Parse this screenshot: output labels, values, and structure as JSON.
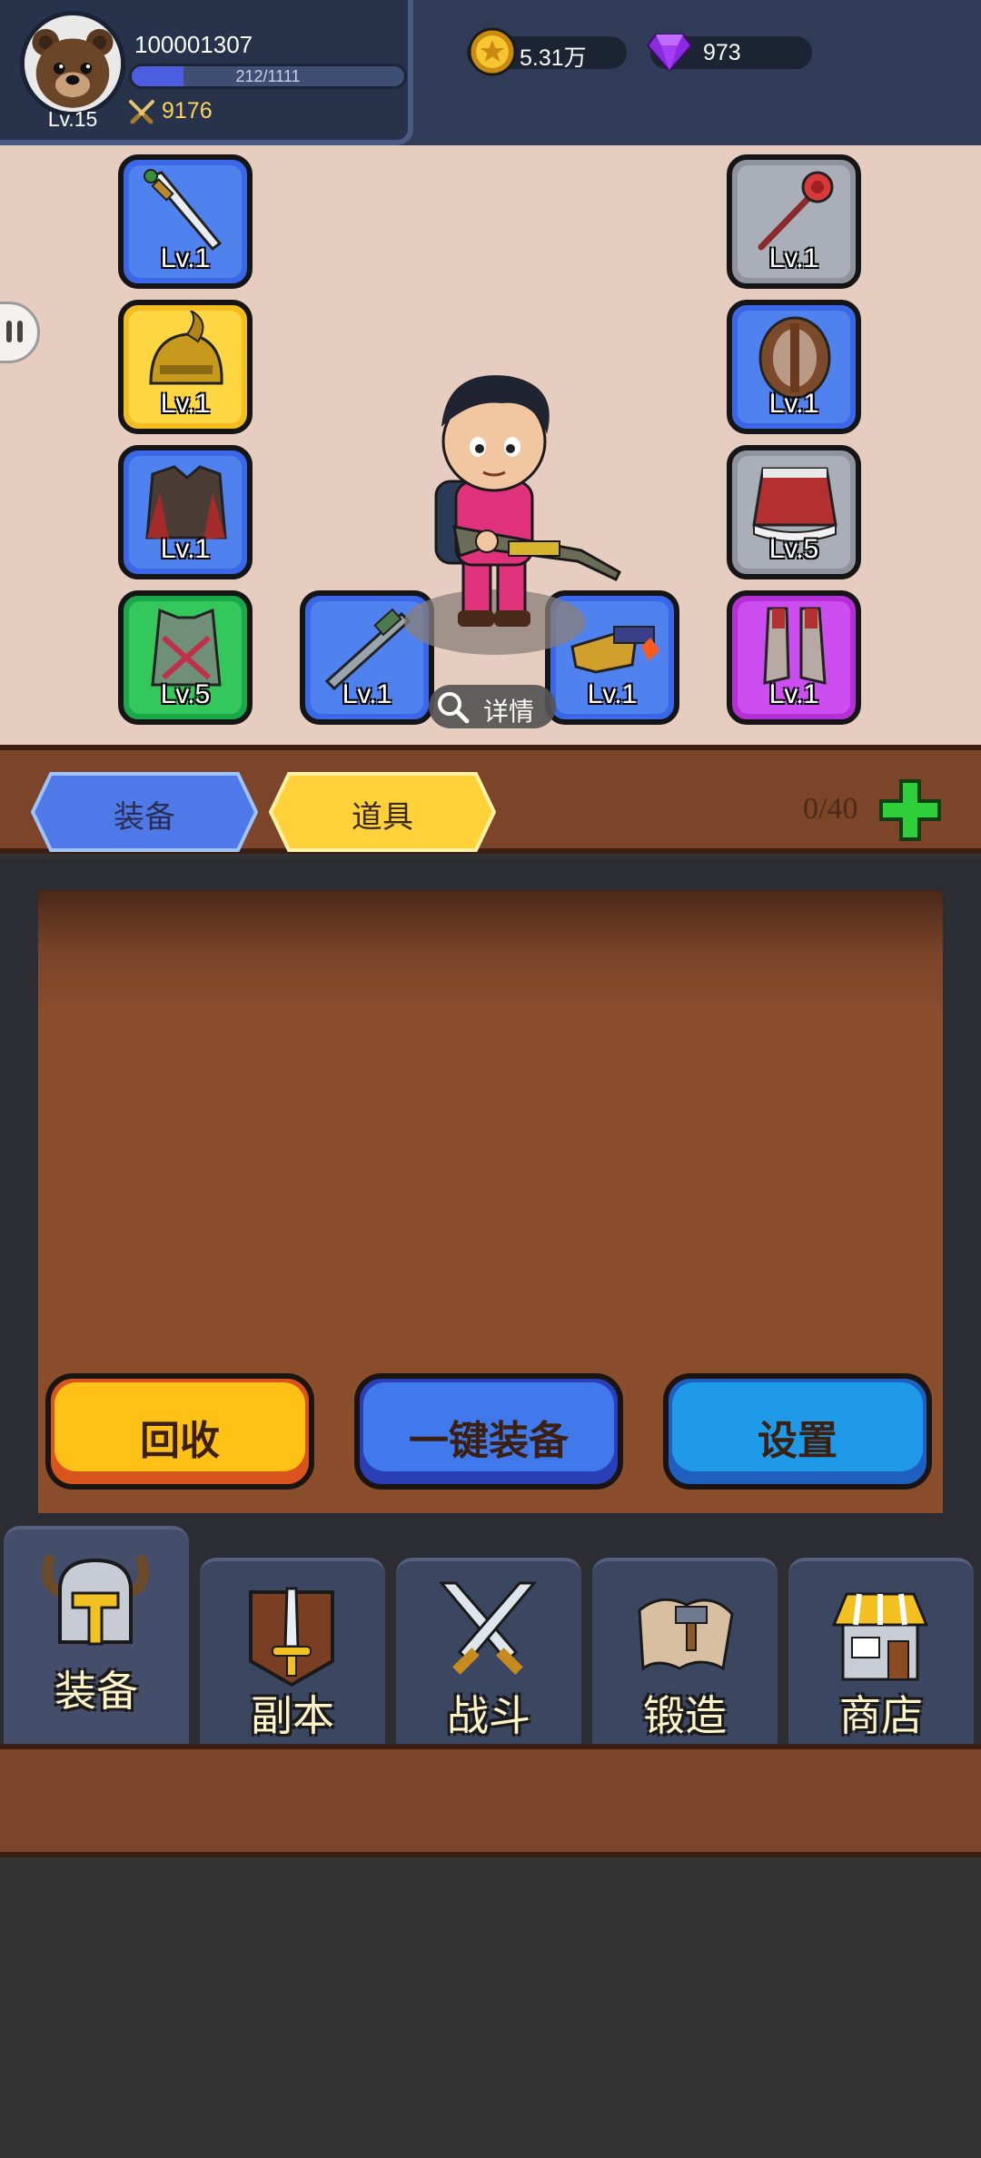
{
  "player": {
    "id": "100001307",
    "level": "Lv.15",
    "xp_text": "212/1111",
    "xp_progress": 0.19,
    "power": "9176"
  },
  "currency": {
    "coins": "5.31万",
    "gems": "973"
  },
  "equipment_slots": [
    {
      "item": "dagger",
      "level": "Lv.1",
      "rarity": "blue"
    },
    {
      "item": "golden-helmet",
      "level": "Lv.1",
      "rarity": "gold"
    },
    {
      "item": "cloak-armor",
      "level": "Lv.1",
      "rarity": "blue"
    },
    {
      "item": "green-vest",
      "level": "Lv.5",
      "rarity": "green"
    },
    {
      "item": "rifle",
      "level": "Lv.1",
      "rarity": "blue"
    },
    {
      "item": "cannon-gun",
      "level": "Lv.1",
      "rarity": "blue"
    },
    {
      "item": "rose-wand",
      "level": "Lv.1",
      "rarity": "gray"
    },
    {
      "item": "round-shield",
      "level": "Lv.1",
      "rarity": "blue"
    },
    {
      "item": "skirt",
      "level": "Lv.5",
      "rarity": "gray"
    },
    {
      "item": "boots",
      "level": "Lv.1",
      "rarity": "purple"
    }
  ],
  "details_label": "详情",
  "tabs": {
    "equip": "装备",
    "items": "道具",
    "capacity": "0/40"
  },
  "actions": {
    "recycle": "回收",
    "auto_equip": "一键装备",
    "settings": "设置"
  },
  "nav": [
    {
      "label": "装备",
      "icon": "helmet-icon"
    },
    {
      "label": "副本",
      "icon": "sword-icon"
    },
    {
      "label": "战斗",
      "icon": "crossed-swords-icon"
    },
    {
      "label": "锻造",
      "icon": "forge-scroll-icon"
    },
    {
      "label": "商店",
      "icon": "shop-icon"
    }
  ],
  "colors": {
    "hud_bg": "#2f3b57",
    "panel_bg": "#e6cdc0",
    "wood": "#7c452a",
    "rarity_blue": "#4f82ee",
    "rarity_gold": "#fed642",
    "rarity_gray": "#a9aeb8",
    "rarity_green": "#34c75b",
    "rarity_purple": "#cd4ef0"
  }
}
